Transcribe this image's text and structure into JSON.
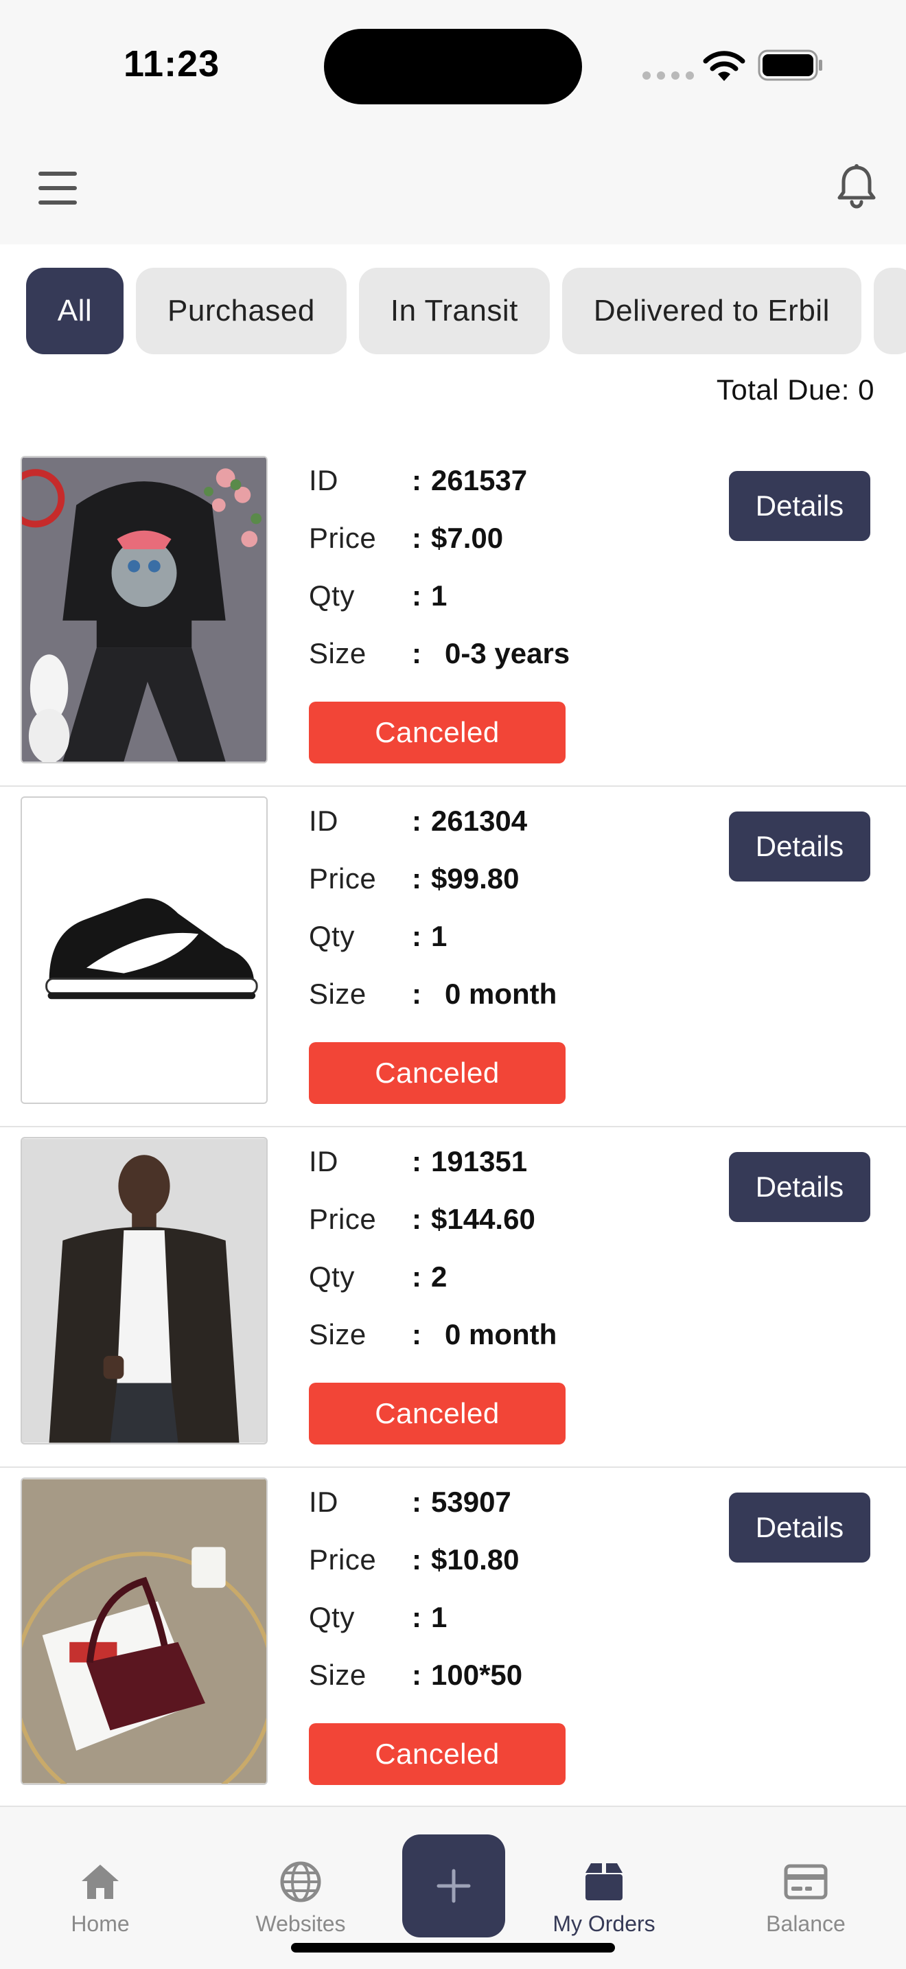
{
  "status_bar": {
    "time": "11:23"
  },
  "filters": [
    "All",
    "Purchased",
    "In Transit",
    "Delivered to Erbil"
  ],
  "summary": {
    "total_due": "Total Due: 0"
  },
  "labels": {
    "id": "ID",
    "price": "Price",
    "qty": "Qty",
    "size": "Size",
    "colon": ":",
    "details": "Details"
  },
  "orders": [
    {
      "id": "261537",
      "price": "$7.00",
      "qty": "1",
      "size": "0-3 years",
      "status": "Canceled",
      "image": "hoodie-set-photo"
    },
    {
      "id": "261304",
      "price": "$99.80",
      "qty": "1",
      "size": "0 month",
      "status": "Canceled",
      "image": "sneaker-photo"
    },
    {
      "id": "191351",
      "price": "$144.60",
      "qty": "2",
      "size": "0 month",
      "status": "Canceled",
      "image": "leather-jacket-photo"
    },
    {
      "id": "53907",
      "price": "$10.80",
      "qty": "1",
      "size": "100*50",
      "status": "Canceled",
      "image": "handbag-photo"
    }
  ],
  "tabbar": {
    "home": "Home",
    "websites": "Websites",
    "my_orders": "My Orders",
    "balance": "Balance"
  },
  "colors": {
    "accent": "#363a57",
    "canceled": "#f24537",
    "chip_bg": "#e8e8e8"
  }
}
